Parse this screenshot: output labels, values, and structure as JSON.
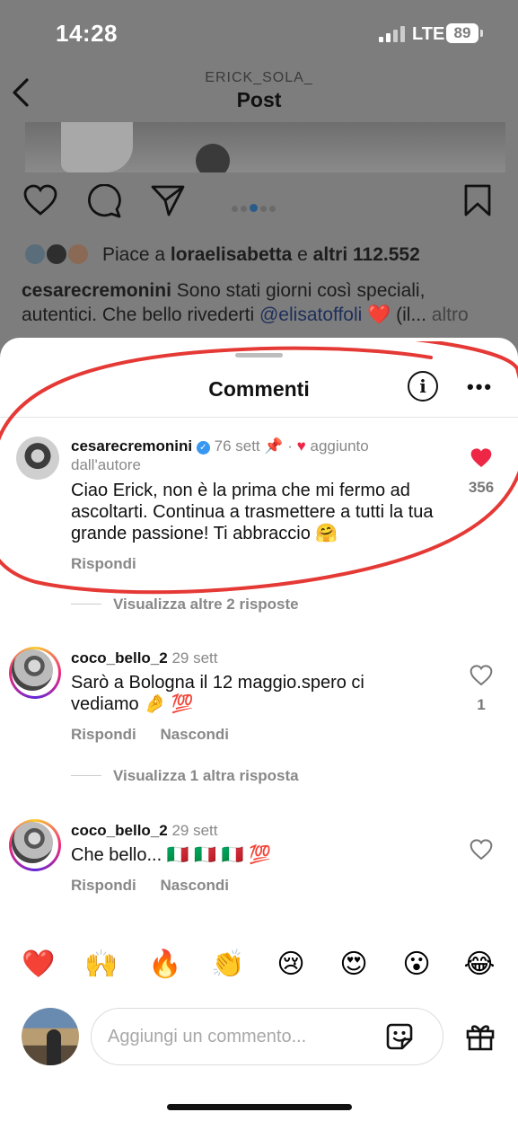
{
  "status_bar": {
    "time": "14:28",
    "network": "LTE",
    "battery": "89"
  },
  "header": {
    "username": "ERICK_SOLA_",
    "title": "Post"
  },
  "post": {
    "likes_prefix": "Piace a ",
    "likes_user": "loraelisabetta",
    "likes_mid": " e ",
    "likes_count": "altri 112.552",
    "caption_user": "cesarecremonini",
    "caption_text": " Sono stati giorni così speciali, autentici. Che bello rivederti ",
    "caption_mention": "@elisatoffoli",
    "caption_tail": " ❤️ (il...",
    "caption_more": " altro"
  },
  "sheet": {
    "title": "Commenti"
  },
  "comments": [
    {
      "username": "cesarecremonini",
      "time": "76 sett",
      "badge": "aggiunto",
      "badge2": "dall'autore",
      "text": "Ciao Erick, non è la prima che mi fermo ad ascoltarti. Continua a trasmettere a tutti la tua grande passione! Ti abbraccio 🤗",
      "reply": "Rispondi",
      "likes": "356",
      "view_replies": "Visualizza altre 2 risposte"
    },
    {
      "username": "coco_bello_2",
      "time": "29 sett",
      "text": "Sarò a Bologna il 12 maggio.spero ci vediamo 🤌 💯",
      "reply": "Rispondi",
      "hide": "Nascondi",
      "likes": "1",
      "view_replies": "Visualizza 1 altra risposta"
    },
    {
      "username": "coco_bello_2",
      "time": "29 sett",
      "text": "Che bello... 🇮🇹 🇮🇹 🇮🇹 💯",
      "reply": "Rispondi",
      "hide": "Nascondi"
    }
  ],
  "emojis": [
    "❤️",
    "🙌",
    "🔥",
    "👏",
    "😢",
    "😍",
    "😮",
    "😂"
  ],
  "composer": {
    "placeholder": "Aggiungi un commento..."
  },
  "colors": {
    "like_red": "#ed2745",
    "annotation": "#e53935",
    "verified": "#3897f0"
  }
}
